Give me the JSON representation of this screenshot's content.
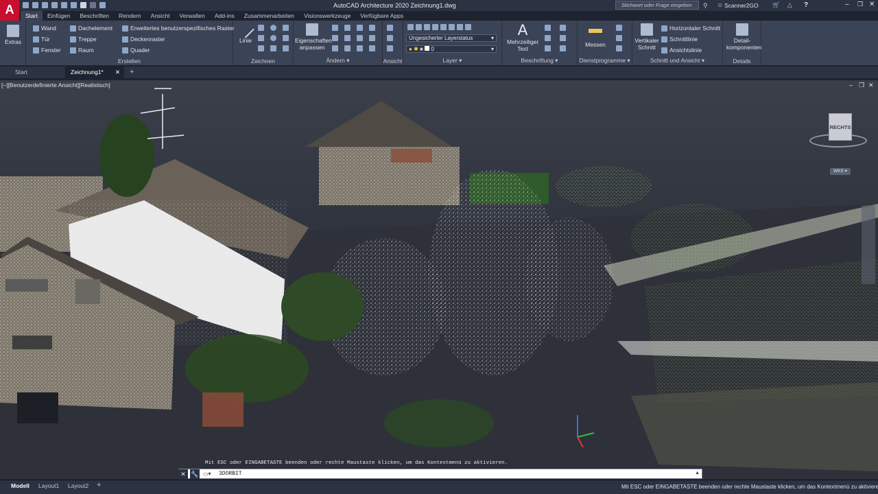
{
  "app": {
    "title": "AutoCAD Architecture 2020   Zeichnung1.dwg",
    "logo": "A",
    "search_placeholder": "Stichwort oder Frage eingeben",
    "user": "Scanner2GO"
  },
  "ribbon_tabs": [
    "Start",
    "Einfügen",
    "Beschriften",
    "Rendern",
    "Ansicht",
    "Verwalten",
    "Add-ins",
    "Zusammenarbeiten",
    "Visionswerkzeuge",
    "Verfügbare Apps"
  ],
  "ribbon": {
    "extras": "Extras",
    "erstellen": {
      "label": "Erstellen",
      "items": [
        "Wand",
        "Tür",
        "Fenster",
        "Dachelement",
        "Treppe",
        "Raum",
        "Erweitertes benutzerspezifisches Raster",
        "Deckenraster",
        "Quader"
      ]
    },
    "zeichnen": {
      "label": "Zeichnen",
      "linie": "Linie"
    },
    "aendern": {
      "label": "Ändern",
      "eigenschaften": "Eigenschaften anpassen"
    },
    "ansicht": {
      "label": "Ansicht"
    },
    "layer": {
      "label": "Layer",
      "layerstatus": "Ungesicherter Layerstatus",
      "current": "0"
    },
    "beschriftung": {
      "label": "Beschriftung",
      "mtext": "Mehrzeiliger Text"
    },
    "dienst": {
      "label": "Dienstprogramme",
      "messen": "Messen"
    },
    "schnitt": {
      "label": "Schnitt und Ansicht",
      "vertikal": "Vertikaler Schnitt",
      "items": [
        "Horizontaler Schnitt",
        "Schnittlinie",
        "Ansichtslinie"
      ]
    },
    "details": {
      "label": "Details",
      "komponenten": "Detail-komponenten"
    }
  },
  "doc_tabs": [
    "Start",
    "Zeichnung1*"
  ],
  "viewport": {
    "label": "[–][Benutzerdefinierte Ansicht][Realistisch]",
    "viewcube": "RECHTS",
    "wks": "WKS"
  },
  "command": {
    "history": "Mit ESC oder EINGABETASTE beenden oder rechte Maustaste klicken, um das Kontextmenü zu aktivieren.",
    "value": "3DORBIT"
  },
  "status": {
    "tabs": [
      "Modell",
      "Layout1",
      "Layout2"
    ],
    "message": "Mit ESC oder EINGABETASTE beenden oder rechte Maustaste klicken, um das Kontextmenü zu aktivieren."
  },
  "colors": {
    "accent": "#c8102e",
    "ribbon": "#3b4356",
    "title": "#2b3242"
  }
}
